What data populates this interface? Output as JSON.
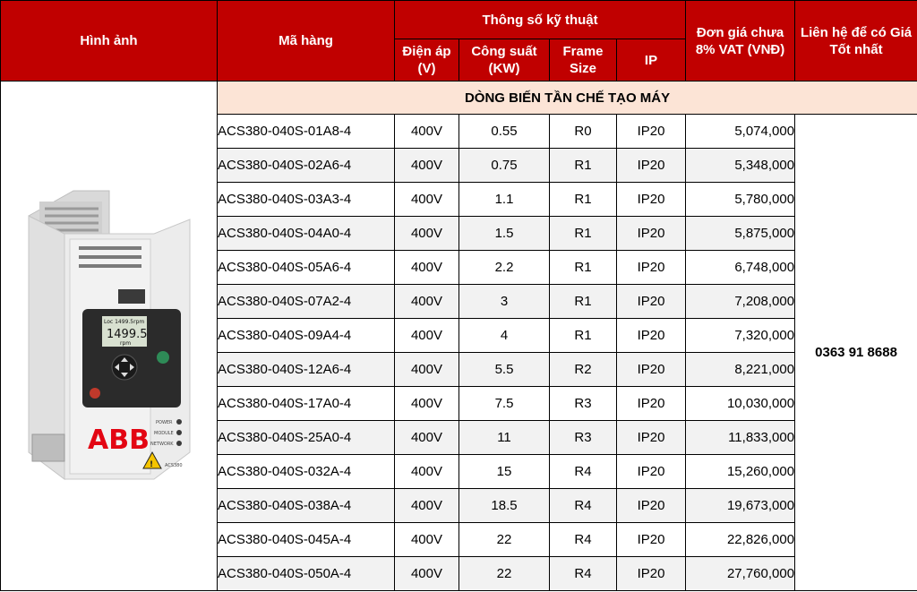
{
  "header": {
    "image": "Hình ảnh",
    "code": "Mã hàng",
    "specs": "Thông số kỹ thuật",
    "voltage": "Điện áp (V)",
    "power": "Công suất (KW)",
    "frame": "Frame Size",
    "ip": "IP",
    "price": "Đơn giá chưa 8% VAT (VNĐ)",
    "contact": "Liên hệ để có Giá Tốt nhất"
  },
  "section_title": "DÒNG BIẾN TẦN CHẾ TẠO MÁY",
  "contact_phone": "0363 91 8688",
  "product_image": {
    "brand": "ABB",
    "display_value": "1499.5",
    "display_unit": "rpm",
    "display_top": "Loc  1499.5rpm",
    "status_labels": [
      "POWER",
      "MODULE",
      "NETWORK"
    ],
    "model_label": "ACS380",
    "colors": {
      "body": "#e6e6e6",
      "brand": "#e30613",
      "display": "#1a1a1a"
    }
  },
  "rows": [
    {
      "code": "ACS380-040S-01A8-4",
      "voltage": "400V",
      "power": "0.55",
      "frame": "R0",
      "ip": "IP20",
      "price": "5,074,000"
    },
    {
      "code": "ACS380-040S-02A6-4",
      "voltage": "400V",
      "power": "0.75",
      "frame": "R1",
      "ip": "IP20",
      "price": "5,348,000"
    },
    {
      "code": "ACS380-040S-03A3-4",
      "voltage": "400V",
      "power": "1.1",
      "frame": "R1",
      "ip": "IP20",
      "price": "5,780,000"
    },
    {
      "code": "ACS380-040S-04A0-4",
      "voltage": "400V",
      "power": "1.5",
      "frame": "R1",
      "ip": "IP20",
      "price": "5,875,000"
    },
    {
      "code": "ACS380-040S-05A6-4",
      "voltage": "400V",
      "power": "2.2",
      "frame": "R1",
      "ip": "IP20",
      "price": "6,748,000"
    },
    {
      "code": "ACS380-040S-07A2-4",
      "voltage": "400V",
      "power": "3",
      "frame": "R1",
      "ip": "IP20",
      "price": "7,208,000"
    },
    {
      "code": "ACS380-040S-09A4-4",
      "voltage": "400V",
      "power": "4",
      "frame": "R1",
      "ip": "IP20",
      "price": "7,320,000"
    },
    {
      "code": "ACS380-040S-12A6-4",
      "voltage": "400V",
      "power": "5.5",
      "frame": "R2",
      "ip": "IP20",
      "price": "8,221,000"
    },
    {
      "code": "ACS380-040S-17A0-4",
      "voltage": "400V",
      "power": "7.5",
      "frame": "R3",
      "ip": "IP20",
      "price": "10,030,000"
    },
    {
      "code": "ACS380-040S-25A0-4",
      "voltage": "400V",
      "power": "11",
      "frame": "R3",
      "ip": "IP20",
      "price": "11,833,000"
    },
    {
      "code": "ACS380-040S-032A-4",
      "voltage": "400V",
      "power": "15",
      "frame": "R4",
      "ip": "IP20",
      "price": "15,260,000"
    },
    {
      "code": "ACS380-040S-038A-4",
      "voltage": "400V",
      "power": "18.5",
      "frame": "R4",
      "ip": "IP20",
      "price": "19,673,000"
    },
    {
      "code": "ACS380-040S-045A-4",
      "voltage": "400V",
      "power": "22",
      "frame": "R4",
      "ip": "IP20",
      "price": "22,826,000"
    },
    {
      "code": "ACS380-040S-050A-4",
      "voltage": "400V",
      "power": "22",
      "frame": "R4",
      "ip": "IP20",
      "price": "27,760,000"
    }
  ]
}
